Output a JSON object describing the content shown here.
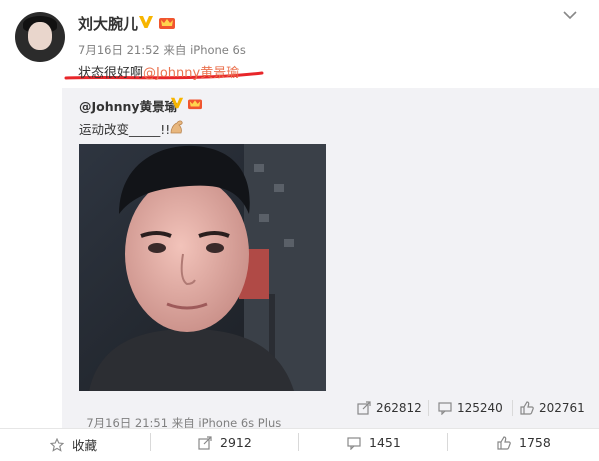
{
  "post": {
    "author": "刘大腕儿",
    "date": "7月16日 21:52",
    "source_prefix": "来自",
    "source_device": "iPhone 6s",
    "text": "状态很好啊",
    "mention": "@Johnny黄景瑜"
  },
  "repost": {
    "author": "@Johnny黄景瑜",
    "text": "运动改变_____!!",
    "date": "7月16日 21:51",
    "source_prefix": "来自",
    "source_device": "iPhone 6s Plus",
    "shares": "262812",
    "comments": "125240",
    "likes": "202761"
  },
  "actions": {
    "favorite_label": "收藏",
    "shares": "2912",
    "comments": "1451",
    "likes": "1758"
  },
  "colors": {
    "mention": "#eb7350",
    "underline": "#e8262a",
    "verified": "#f7b500",
    "repost_bg": "#f2f2f5"
  }
}
